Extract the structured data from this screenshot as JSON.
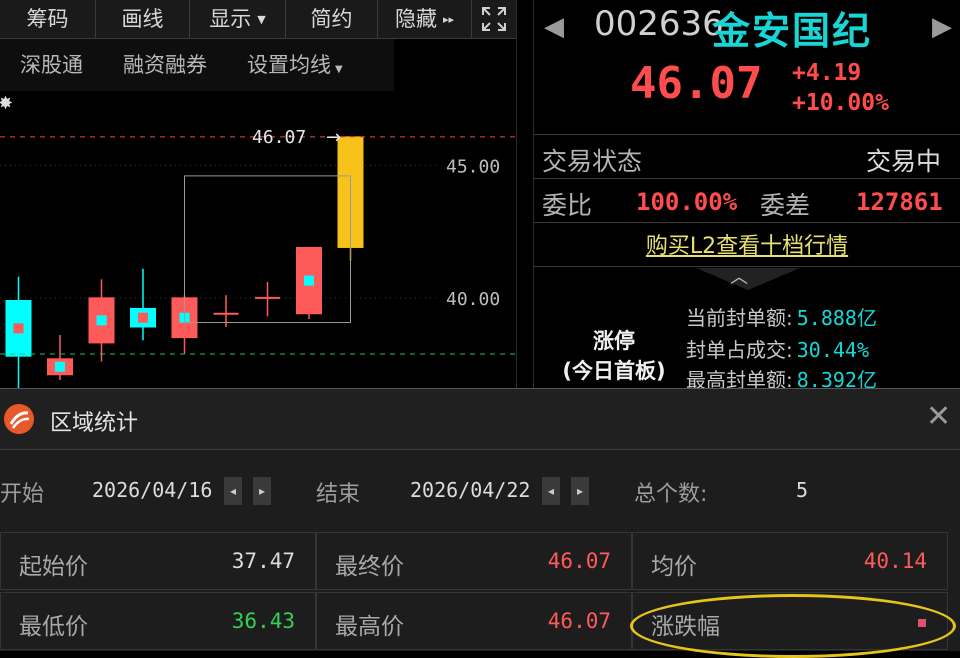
{
  "toolbar": {
    "items": [
      {
        "label": "筹码",
        "dropdown": false
      },
      {
        "label": "画线",
        "dropdown": false
      },
      {
        "label": "显示",
        "dropdown": true
      },
      {
        "label": "简约",
        "dropdown": false
      },
      {
        "label": "隐藏",
        "dropdown": false,
        "suffix": "▸▸"
      }
    ],
    "fullscreen_icon": "fullscreen-icon",
    "dropdown_glyph": "▼"
  },
  "subtabs": [
    {
      "label": "深股通",
      "dropdown": false
    },
    {
      "label": "融资融券",
      "dropdown": false
    },
    {
      "label": "设置均线",
      "dropdown": true
    }
  ],
  "chart_data": {
    "type": "candlestick",
    "marker_label": "46.07",
    "marker_arrow": "→",
    "y_ticks": [
      45.0,
      40.0
    ],
    "y_tick_labels": [
      "45.00",
      "40.00"
    ],
    "ylim": [
      36.6,
      47.8
    ],
    "limit_price": 46.07,
    "reference_price": 37.88,
    "candles": [
      {
        "open": 39.9,
        "close": 37.8,
        "high": 40.8,
        "low": 36.6,
        "color": "cyan"
      },
      {
        "open": 37.7,
        "close": 37.1,
        "high": 38.6,
        "low": 36.9,
        "color": "red"
      },
      {
        "open": 38.3,
        "close": 40.0,
        "high": 40.7,
        "low": 37.6,
        "color": "red"
      },
      {
        "open": 38.9,
        "close": 39.6,
        "high": 41.1,
        "low": 38.4,
        "color": "cyan"
      },
      {
        "open": 38.5,
        "close": 40.0,
        "high": 40.1,
        "low": 37.9,
        "color": "red"
      },
      {
        "open": 39.3,
        "close": 39.4,
        "high": 40.1,
        "low": 38.9,
        "color": "red"
      },
      {
        "open": 40.0,
        "close": 40.0,
        "high": 40.6,
        "low": 39.3,
        "color": "red"
      },
      {
        "open": 39.4,
        "close": 41.9,
        "high": 41.9,
        "low": 39.2,
        "color": "red"
      },
      {
        "open": 41.9,
        "close": 46.07,
        "high": 46.07,
        "low": 41.4,
        "color": "yellow"
      }
    ],
    "selection": {
      "from_index": 4,
      "to_index": 8
    },
    "colors": {
      "up": "#ff5a5a",
      "down": "#00ffff",
      "limit_up": "#f7c21a",
      "dashed_red": "#ff4040",
      "dashed_green": "#22c55e"
    }
  },
  "quote": {
    "code": "002636",
    "name": "金安国纪",
    "price": "46.07",
    "change": "+4.19",
    "change_pct": "+10.00%",
    "prev_icon": "◀",
    "next_icon": "▶",
    "status_label": "交易状态",
    "status_value": "交易中",
    "weibi_label": "委比",
    "weibi_value": "100.00%",
    "weicha_label": "委差",
    "weicha_value": "127861",
    "buy_l2": "购买L2查看十档行情",
    "collapse_icon": "chevron-up-icon",
    "limit_title_1": "涨停",
    "limit_title_2": "(今日首板)",
    "seal_rows": [
      {
        "label": "当前封单额:",
        "value": "5.888亿"
      },
      {
        "label": "封单占成交:",
        "value": "30.44%"
      },
      {
        "label": "最高封单额:",
        "value": "8.392亿"
      }
    ],
    "colors": {
      "up": "#ff4d4d",
      "name": "#19d6d6"
    }
  },
  "dialog": {
    "title": "区域统计",
    "close_glyph": "✕",
    "start_label": "开始",
    "start_date": "2026/04/16",
    "end_label": "结束",
    "end_date": "2026/04/22",
    "count_label": "总个数:",
    "count_value": "5",
    "spin_left": "◂",
    "spin_right": "▸",
    "stats": [
      {
        "label": "起始价",
        "value": "37.47",
        "color": "#dcdcdc"
      },
      {
        "label": "最终价",
        "value": "46.07",
        "color": "#ff5a5a"
      },
      {
        "label": "均价",
        "value": "40.14",
        "color": "#ff5a5a"
      },
      {
        "label": "最低价",
        "value": "36.43",
        "color": "#34d058"
      },
      {
        "label": "最高价",
        "value": "46.07",
        "color": "#ff5a5a"
      },
      {
        "label": "涨跌幅",
        "value": "",
        "color": "#ff5a5a"
      }
    ],
    "highlight_color": "#e6c419"
  }
}
